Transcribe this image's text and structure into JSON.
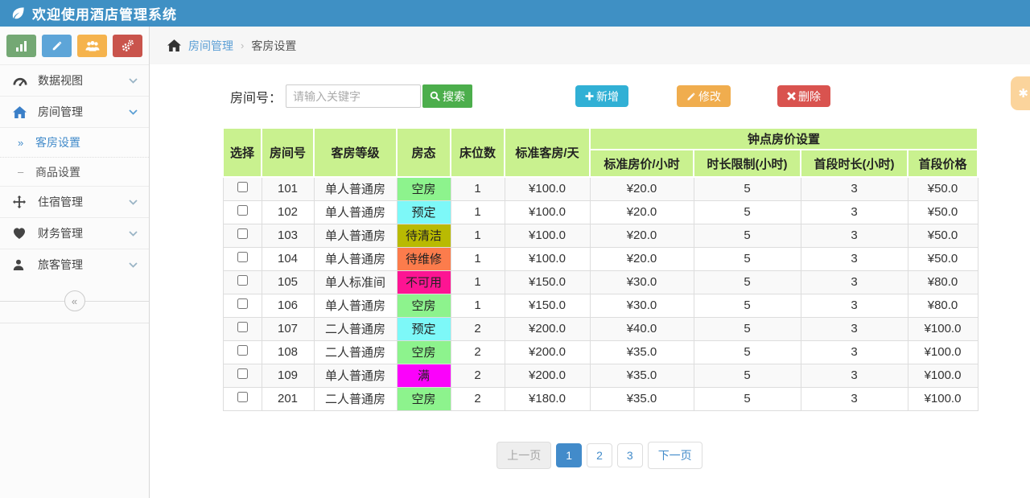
{
  "header": {
    "title": "欢迎使用酒店管理系统"
  },
  "breadcrumb": {
    "section": "房间管理",
    "separator": "›",
    "current": "客房设置"
  },
  "ui_colors": {
    "topbar": "#3f90c4",
    "accent": "#428bca",
    "table_header_green": "#c9f18f",
    "search_green": "#4cae4c",
    "add_blue": "#31b0d5",
    "edit_orange": "#f0ad4e",
    "delete_red": "#d9534f",
    "floating_tab_orange": "#fbd49c"
  },
  "sidebar": {
    "quick_buttons": [
      {
        "icon": "chart-icon",
        "color": "#74a874"
      },
      {
        "icon": "pencil-icon",
        "color": "#5da5d8"
      },
      {
        "icon": "users-icon",
        "color": "#f5b34d"
      },
      {
        "icon": "gears-icon",
        "color": "#c9544c"
      }
    ],
    "menu": [
      {
        "label": "数据视图",
        "icon": "dashboard-icon"
      },
      {
        "label": "房间管理",
        "icon": "home-icon",
        "children": [
          {
            "label": "客房设置",
            "marker": "»",
            "active": true
          },
          {
            "label": "商品设置",
            "marker": "–",
            "active": false
          }
        ]
      },
      {
        "label": "住宿管理",
        "icon": "move-icon"
      },
      {
        "label": "财务管理",
        "icon": "heart-icon"
      },
      {
        "label": "旅客管理",
        "icon": "user-icon"
      }
    ],
    "collapse_label": "«"
  },
  "toolbar": {
    "search_label": "房间号：",
    "search_placeholder": "请输入关键字",
    "search_button": "搜索",
    "add_label": "新增",
    "edit_label": "修改",
    "delete_label": "删除"
  },
  "table": {
    "group_header": "钟点房价设置",
    "columns": [
      "选择",
      "房间号",
      "客房等级",
      "房态",
      "床位数",
      "标准客房/天",
      "标准房价/小时",
      "时长限制(小时)",
      "首段时长(小时)",
      "首段价格"
    ],
    "status_colors": {
      "空房": "#8df38d",
      "预定": "#7df8f8",
      "待清洁": "#b9ba02",
      "待维修": "#fc7c4c",
      "不可用": "#fd1493",
      "满": "#fb02fb"
    },
    "rows": [
      {
        "room": "101",
        "grade": "单人普通房",
        "status": "空房",
        "status_color": "#8df38d",
        "beds": "1",
        "day_price": "¥100.0",
        "hour_price": "¥20.0",
        "limit": "5",
        "first_len": "3",
        "first_price": "¥50.0"
      },
      {
        "room": "102",
        "grade": "单人普通房",
        "status": "预定",
        "status_color": "#7df8f8",
        "beds": "1",
        "day_price": "¥100.0",
        "hour_price": "¥20.0",
        "limit": "5",
        "first_len": "3",
        "first_price": "¥50.0"
      },
      {
        "room": "103",
        "grade": "单人普通房",
        "status": "待清洁",
        "status_color": "#b9ba02",
        "beds": "1",
        "day_price": "¥100.0",
        "hour_price": "¥20.0",
        "limit": "5",
        "first_len": "3",
        "first_price": "¥50.0"
      },
      {
        "room": "104",
        "grade": "单人普通房",
        "status": "待维修",
        "status_color": "#fc7c4c",
        "beds": "1",
        "day_price": "¥100.0",
        "hour_price": "¥20.0",
        "limit": "5",
        "first_len": "3",
        "first_price": "¥50.0"
      },
      {
        "room": "105",
        "grade": "单人标准间",
        "status": "不可用",
        "status_color": "#fd1493",
        "beds": "1",
        "day_price": "¥150.0",
        "hour_price": "¥30.0",
        "limit": "5",
        "first_len": "3",
        "first_price": "¥80.0"
      },
      {
        "room": "106",
        "grade": "单人普通房",
        "status": "空房",
        "status_color": "#8df38d",
        "beds": "1",
        "day_price": "¥150.0",
        "hour_price": "¥30.0",
        "limit": "5",
        "first_len": "3",
        "first_price": "¥80.0"
      },
      {
        "room": "107",
        "grade": "二人普通房",
        "status": "预定",
        "status_color": "#7df8f8",
        "beds": "2",
        "day_price": "¥200.0",
        "hour_price": "¥40.0",
        "limit": "5",
        "first_len": "3",
        "first_price": "¥100.0"
      },
      {
        "room": "108",
        "grade": "二人普通房",
        "status": "空房",
        "status_color": "#8df38d",
        "beds": "2",
        "day_price": "¥200.0",
        "hour_price": "¥35.0",
        "limit": "5",
        "first_len": "3",
        "first_price": "¥100.0"
      },
      {
        "room": "109",
        "grade": "单人普通房",
        "status": "满",
        "status_color": "#fb02fb",
        "beds": "2",
        "day_price": "¥200.0",
        "hour_price": "¥35.0",
        "limit": "5",
        "first_len": "3",
        "first_price": "¥100.0"
      },
      {
        "room": "201",
        "grade": "二人普通房",
        "status": "空房",
        "status_color": "#8df38d",
        "beds": "2",
        "day_price": "¥180.0",
        "hour_price": "¥35.0",
        "limit": "5",
        "first_len": "3",
        "first_price": "¥100.0"
      }
    ]
  },
  "pagination": {
    "prev": "上一页",
    "pages": [
      "1",
      "2",
      "3"
    ],
    "active": "1",
    "next": "下一页"
  }
}
